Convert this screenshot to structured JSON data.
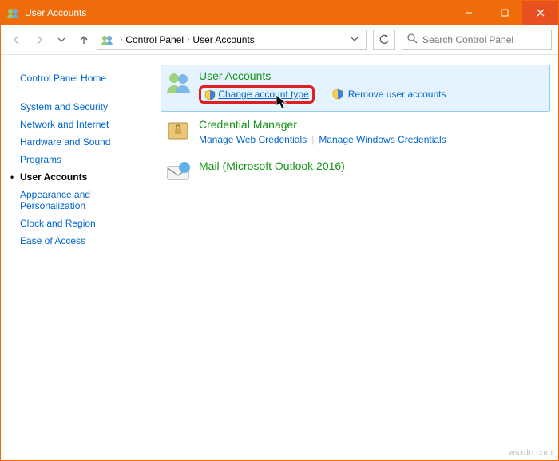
{
  "window": {
    "title": "User Accounts"
  },
  "breadcrumb": {
    "seg1": "Control Panel",
    "seg2": "User Accounts"
  },
  "search": {
    "placeholder": "Search Control Panel"
  },
  "sidebar": {
    "home": "Control Panel Home",
    "items": [
      "System and Security",
      "Network and Internet",
      "Hardware and Sound",
      "Programs",
      "User Accounts",
      "Appearance and Personalization",
      "Clock and Region",
      "Ease of Access"
    ]
  },
  "categories": {
    "user_accounts": {
      "title": "User Accounts",
      "change_type": "Change account type",
      "remove": "Remove user accounts"
    },
    "credential_manager": {
      "title": "Credential Manager",
      "web": "Manage Web Credentials",
      "win": "Manage Windows Credentials"
    },
    "mail": {
      "title": "Mail (Microsoft Outlook 2016)"
    }
  },
  "watermark": "wsxdn.com"
}
